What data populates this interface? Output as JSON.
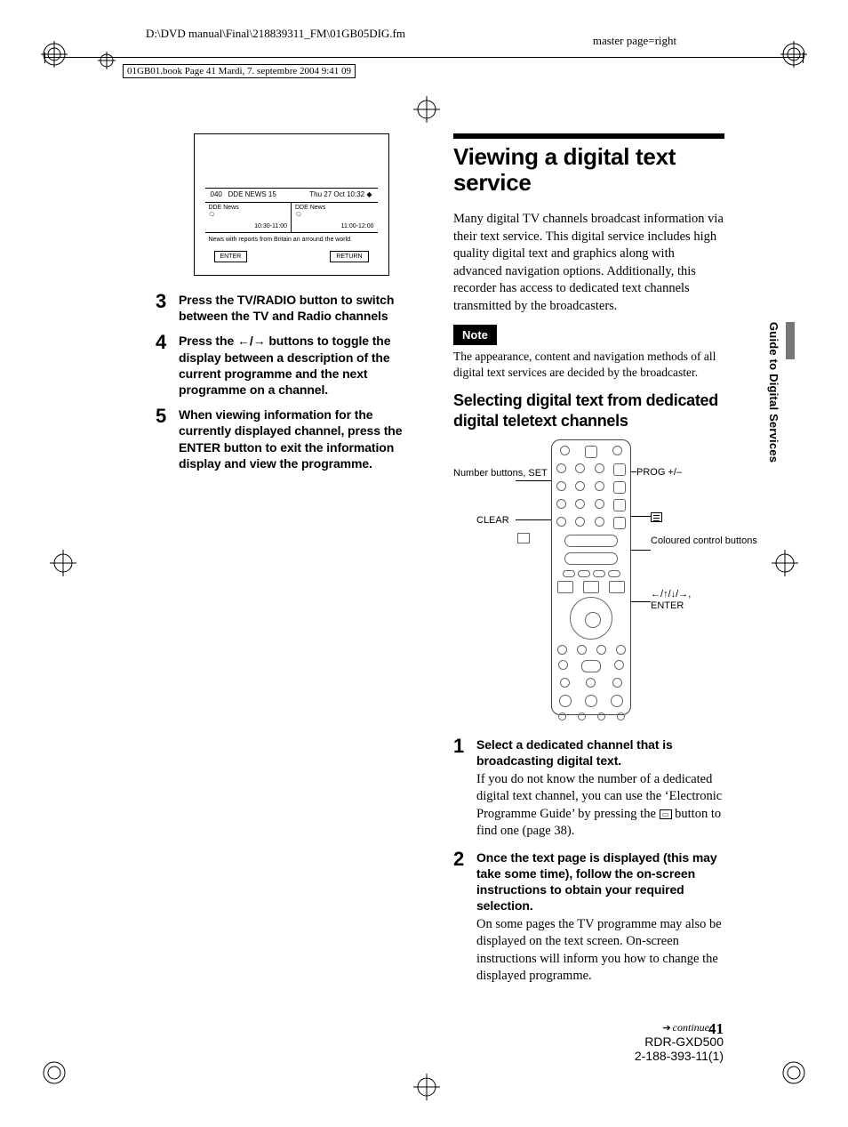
{
  "header": {
    "left_path": "D:\\DVD manual\\Final\\218839311_FM\\01GB05DIG.fm",
    "right_master": "master page=right",
    "crop_text": "01GB01.book  Page 41  Mardi, 7. septembre 2004  9:41 09"
  },
  "left_column": {
    "miniscreen": {
      "ch_num": "040",
      "ch_name": "DDE NEWS 15",
      "datetime": "Thu 27 Oct  10:32",
      "prog1_title": "DDE News",
      "prog1_time": "10:30-11:00",
      "prog2_title": "DDE News",
      "prog2_time": "11:00-12:00",
      "desc": "News with reports from Britain an arround the world.",
      "btn_enter": "ENTER",
      "btn_return": "RETURN"
    },
    "steps": [
      {
        "n": "3",
        "head": "Press the TV/RADIO button to switch between the TV and Radio channels"
      },
      {
        "n": "4",
        "head_pre": "Press the ",
        "head_post": " buttons to toggle the display between a description of the current programme and the next programme on a channel."
      },
      {
        "n": "5",
        "head": "When viewing information for the currently displayed channel, press the ENTER button to exit the information display and view the programme."
      }
    ]
  },
  "right_column": {
    "h1": "Viewing a digital text service",
    "intro": "Many digital TV channels broadcast information via their text service. This digital service includes high quality digital text and graphics along with advanced navigation options. Additionally, this recorder has access to dedicated text channels transmitted by the broadcasters.",
    "note_label": "Note",
    "note_text": "The appearance, content and navigation methods of all digital text services are decided by the broadcaster.",
    "h2": "Selecting digital text from dedicated digital teletext channels",
    "remote_labels": {
      "number_set": "Number buttons, SET",
      "clear": "CLEAR",
      "prog": "PROG +/–",
      "coloured": "Coloured control buttons",
      "arrows_enter": "←/↑/↓/→, ENTER"
    },
    "steps": [
      {
        "n": "1",
        "head": "Select a dedicated channel that is broadcasting digital text.",
        "desc_pre": "If you do not know the number of a dedicated digital text channel, you can use the ‘Electronic Programme Guide’ by pressing the ",
        "desc_post": " button to find one (page 38)."
      },
      {
        "n": "2",
        "head": "Once the text page is displayed (this may take some time), follow the on-screen instructions to obtain your required selection.",
        "desc": "On some pages the TV programme may also be displayed on the text screen. On-screen instructions will inform you how to change the displayed programme."
      }
    ]
  },
  "side_tab": "Guide to Digital Services",
  "footer": {
    "continued": "continued",
    "page": "41",
    "model": "RDR-GXD500",
    "doc": "2-188-393-11(1)"
  }
}
